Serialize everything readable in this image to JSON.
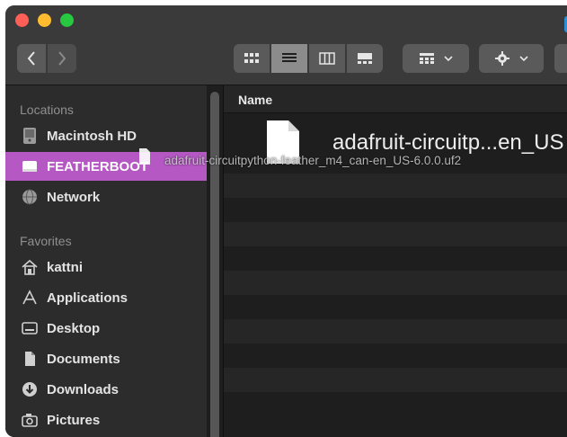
{
  "toolbar": {
    "back_icon": "chevron-left-icon",
    "forward_icon": "chevron-right-icon",
    "views": [
      "icon-view",
      "list-view",
      "column-view",
      "gallery-view"
    ],
    "group_icon": "group-grid-icon",
    "action_icon": "gear-icon"
  },
  "sidebar": {
    "locations_heading": "Locations",
    "locations": [
      {
        "label": "Macintosh HD",
        "icon": "hard-drive-icon"
      },
      {
        "label": "FEATHERBOOT",
        "icon": "external-drive-icon",
        "selected": true
      },
      {
        "label": "Network",
        "icon": "globe-icon"
      }
    ],
    "favorites_heading": "Favorites",
    "favorites": [
      {
        "label": "kattni",
        "icon": "home-icon"
      },
      {
        "label": "Applications",
        "icon": "applications-icon"
      },
      {
        "label": "Desktop",
        "icon": "desktop-icon"
      },
      {
        "label": "Documents",
        "icon": "documents-icon"
      },
      {
        "label": "Downloads",
        "icon": "downloads-icon"
      },
      {
        "label": "Pictures",
        "icon": "camera-icon"
      }
    ]
  },
  "content": {
    "column_name": "Name",
    "file_name": "adafruit-circuitp...en_US",
    "drag_label": "adafruit-circuitpython-feather_m4_can-en_US-6.0.0.uf2"
  },
  "colors": {
    "selection": "#b558c4",
    "sidebar": "#2c2c2c",
    "content": "#1e1e1e"
  }
}
